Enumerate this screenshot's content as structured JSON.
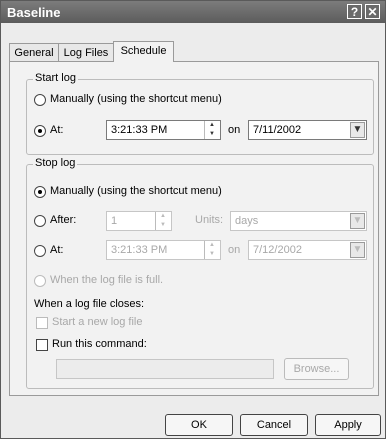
{
  "window": {
    "title": "Baseline",
    "help_label": "?",
    "close_label": "✕"
  },
  "tabs": [
    {
      "label": "General",
      "active": false
    },
    {
      "label": "Log Files",
      "active": false
    },
    {
      "label": "Schedule",
      "active": true
    }
  ],
  "start_log": {
    "legend": "Start log",
    "manual_label": "Manually (using the shortcut menu)",
    "at_label": "At:",
    "time": "3:21:33 PM",
    "on_label": "on",
    "date": "7/11/2002",
    "selected": "at"
  },
  "stop_log": {
    "legend": "Stop log",
    "manual_label": "Manually (using the shortcut menu)",
    "after_label": "After:",
    "after_value": "1",
    "units_label": "Units:",
    "units_value": "days",
    "at_label": "At:",
    "time": "3:21:33 PM",
    "on_label": "on",
    "date": "7/12/2002",
    "when_full_label": "When the log file is full.",
    "when_closes_label": "When a log file closes:",
    "start_new_label": "Start a new log file",
    "run_command_label": "Run this command:",
    "command_value": "",
    "browse_label": "Browse...",
    "selected": "manual"
  },
  "footer": {
    "ok_label": "OK",
    "cancel_label": "Cancel",
    "apply_label": "Apply"
  }
}
